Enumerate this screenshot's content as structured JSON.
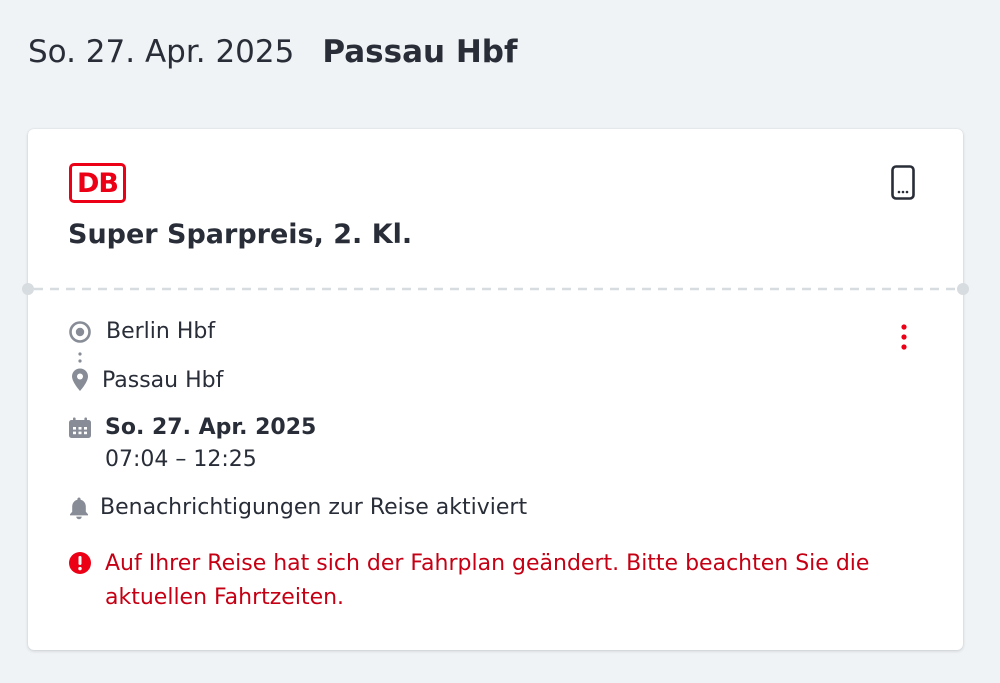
{
  "header": {
    "date": "So. 27. Apr. 2025",
    "station": "Passau Hbf"
  },
  "card": {
    "logo_text": "DB",
    "ticket_title": "Super Sparpreis, 2. Kl.",
    "from_station": "Berlin Hbf",
    "to_station": "Passau Hbf",
    "travel_date": "So. 27. Apr. 2025",
    "time_range": "07:04 – 12:25",
    "notification_text": "Benachrichtigungen zur Reise aktiviert",
    "warning_text": "Auf Ihrer Reise hat sich der Fahrplan geändert. Bitte beachten Sie die aktuellen Fahrtzeiten."
  },
  "icons": {
    "logo": "db-logo",
    "phone": "mobile-phone-icon",
    "more": "more-vertical-icon",
    "origin": "origin-circle-icon",
    "destination": "location-pin-icon",
    "calendar": "calendar-icon",
    "bell": "bell-icon",
    "warning": "warning-icon"
  },
  "colors": {
    "background": "#f0f3f5",
    "card": "#ffffff",
    "brand_red": "#ec0016",
    "warning_red": "#c50014",
    "text": "#282d37",
    "icon_gray": "#878c96"
  }
}
